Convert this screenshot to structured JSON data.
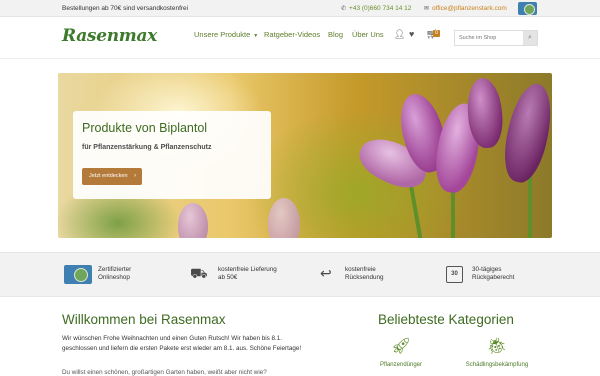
{
  "topbar": {
    "promo": "Bestellungen ab 70€ sind versandkostenfrei",
    "phone": "+43 (0)660 734 14 12",
    "email": "office@pflanzenstark.com"
  },
  "header": {
    "logo": "Rasenmax",
    "nav": {
      "produkte": "Unsere Produkte",
      "videos": "Ratgeber-Videos",
      "blog": "Blog",
      "ueber": "Über Uns"
    },
    "cart_count": "0",
    "search_placeholder": "Suche im Shop"
  },
  "hero": {
    "title": "Produkte von Biplantol",
    "subtitle": "für Pflanzenstärkung & Pflanzenschutz",
    "button": "Jetzt entdecken"
  },
  "usps": [
    {
      "line1": "Zertifizierter",
      "line2": "Onlineshop",
      "icon": "certified-seal-icon"
    },
    {
      "line1": "kostenfreie Lieferung",
      "line2": "ab 50€",
      "icon": "delivery-truck-icon"
    },
    {
      "line1": "kostenfreie",
      "line2": "Rücksendung",
      "icon": "return-arrow-icon"
    },
    {
      "line1": "30-tägiges",
      "line2": "Rückgaberecht",
      "icon": "calendar-30-icon",
      "icon_text": "30"
    }
  ],
  "welcome": {
    "title": "Willkommen bei Rasenmax",
    "text": "Wir wünschen Frohe Weihnachten und einen Guten Rutsch! Wir haben bis 8.1. geschlossen und liefern die ersten Pakete erst wieder am 8.1. aus. Schöne Feiertage!",
    "more": "Du willst einen schönen, großartigen Garten haben, weißt aber nicht wie?"
  },
  "categories": {
    "title": "Beliebteste Kategorien",
    "items": [
      {
        "label": "Pflanzendünger",
        "icon": "rocket-icon"
      },
      {
        "label": "Schädlingsbekämpfung",
        "icon": "bug-icon"
      }
    ]
  },
  "colors": {
    "brand_green": "#3e6b21",
    "accent_orange": "#c8811a",
    "button_brown": "#b37a3a"
  }
}
